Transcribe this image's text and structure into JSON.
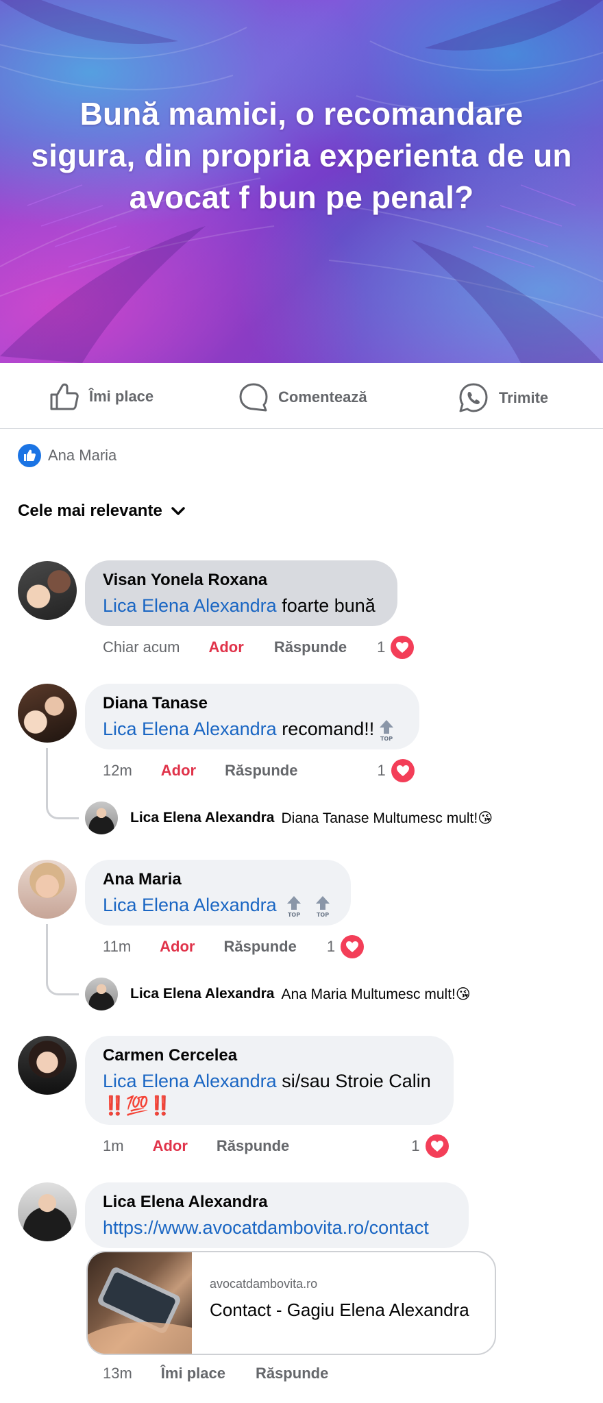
{
  "post": {
    "title": "Bună mamici, o recomandare sigura, din propria experienta de un avocat f bun pe penal?"
  },
  "actions": {
    "like": "Îmi place",
    "comment": "Comentează",
    "share": "Trimite"
  },
  "reactions": {
    "names": "Ana Maria"
  },
  "sort": {
    "label": "Cele mai relevante"
  },
  "comments": [
    {
      "author": "Visan Yonela Roxana",
      "mention": "Lica Elena Alexandra",
      "text": "foarte bună",
      "time": "Chiar acum",
      "reaction_label": "Ador",
      "reply_label": "Răspunde",
      "reaction_count": "1"
    },
    {
      "author": "Diana Tanase",
      "mention": "Lica Elena Alexandra",
      "text": "recomand!!",
      "time": "12m",
      "reaction_label": "Ador",
      "reply_label": "Răspunde",
      "reaction_count": "1",
      "reply": {
        "author": "Lica Elena Alexandra",
        "text": "Diana Tanase Multumesc mult!😘"
      }
    },
    {
      "author": "Ana Maria",
      "mention": "Lica Elena Alexandra",
      "text": "",
      "time": "11m",
      "reaction_label": "Ador",
      "reply_label": "Răspunde",
      "reaction_count": "1",
      "reply": {
        "author": "Lica Elena Alexandra",
        "text": "Ana Maria Multumesc mult!😘"
      }
    },
    {
      "author": "Carmen Cercelea",
      "mention": "Lica Elena Alexandra",
      "text": "si/sau Stroie Calin",
      "emoji_line": "‼️💯‼️",
      "time": "1m",
      "reaction_label": "Ador",
      "reply_label": "Răspunde",
      "reaction_count": "1"
    },
    {
      "author": "Lica Elena Alexandra",
      "link": "https://www.avocatdambovita.ro/contact",
      "time": "13m",
      "like_label": "Îmi place",
      "reply_label": "Răspunde",
      "preview": {
        "domain": "avocatdambovita.ro",
        "title": "Contact - Gagiu Elena Alexandra"
      }
    }
  ],
  "badges": {
    "top": "TOP"
  },
  "colors": {
    "mention": "#1a66c3",
    "ador": "#e0334a",
    "heart": "#f33e58",
    "like_blue": "#1b74e4"
  }
}
